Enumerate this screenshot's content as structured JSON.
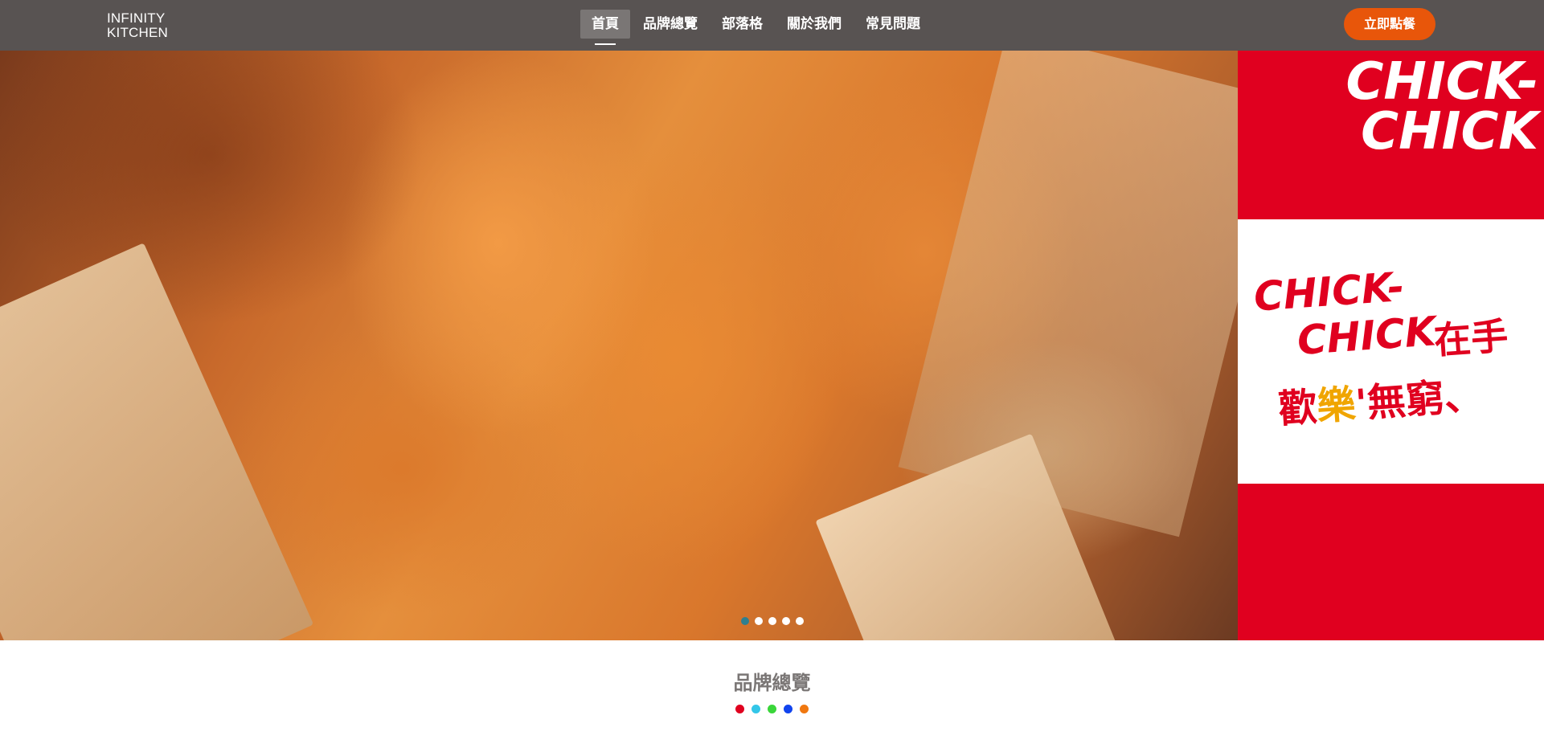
{
  "brand": {
    "logo_line1": "INFINITY",
    "logo_line2": "KITCHEN"
  },
  "nav": {
    "items": [
      {
        "label": "首頁",
        "active": true
      },
      {
        "label": "品牌總覽",
        "active": false
      },
      {
        "label": "部落格",
        "active": false
      },
      {
        "label": "關於我們",
        "active": false
      },
      {
        "label": "常見問題",
        "active": false
      }
    ],
    "cta_label": "立即點餐"
  },
  "hero": {
    "ad_top_text": "CHICK-\nCHICK",
    "ad_chick": "CHICK-",
    "ad_chick_line2": "CHICK",
    "ad_zaishou": "在手",
    "ad_slogan_part1": "歡",
    "ad_slogan_part2": "樂",
    "ad_slogan_part3": "'無窮、",
    "slide_count": 5,
    "active_slide": 1
  },
  "section": {
    "title": "品牌總覽",
    "accent_dots": [
      "#e0001f",
      "#33c6e8",
      "#3ad63a",
      "#1144ee",
      "#f07810"
    ]
  },
  "colors": {
    "header_bg": "#585352",
    "cta": "#e8560a",
    "ad_red": "#e0001f"
  }
}
